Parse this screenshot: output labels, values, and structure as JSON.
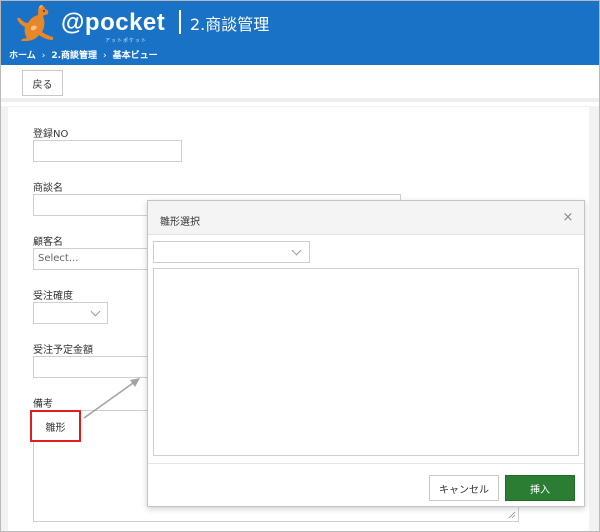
{
  "app": {
    "logo_text": "@pocket",
    "logo_subtext": "アットポケット",
    "page_title": "2.商談管理"
  },
  "breadcrumb": {
    "items": [
      "ホーム",
      "2.商談管理",
      "基本ビュー"
    ],
    "separator": "›"
  },
  "toolbar": {
    "back_label": "戻る"
  },
  "form": {
    "registration_no": {
      "label": "登録NO",
      "value": ""
    },
    "deal_name": {
      "label": "商談名",
      "value": ""
    },
    "customer_name": {
      "label": "顧客名",
      "placeholder": "Select..."
    },
    "order_probability": {
      "label": "受注確度",
      "value": ""
    },
    "expected_amount": {
      "label": "受注予定金額",
      "value": ""
    },
    "remarks": {
      "label": "備考",
      "value": ""
    },
    "template_button_label": "雛形"
  },
  "modal": {
    "title": "雛形選択",
    "close_symbol": "×",
    "template_select_value": "",
    "template_content": "",
    "cancel_label": "キャンセル",
    "insert_label": "挿入"
  },
  "colors": {
    "header_bg": "#1a72c6",
    "insert_button": "#2a7d32",
    "highlight_border": "#e01e1e"
  }
}
